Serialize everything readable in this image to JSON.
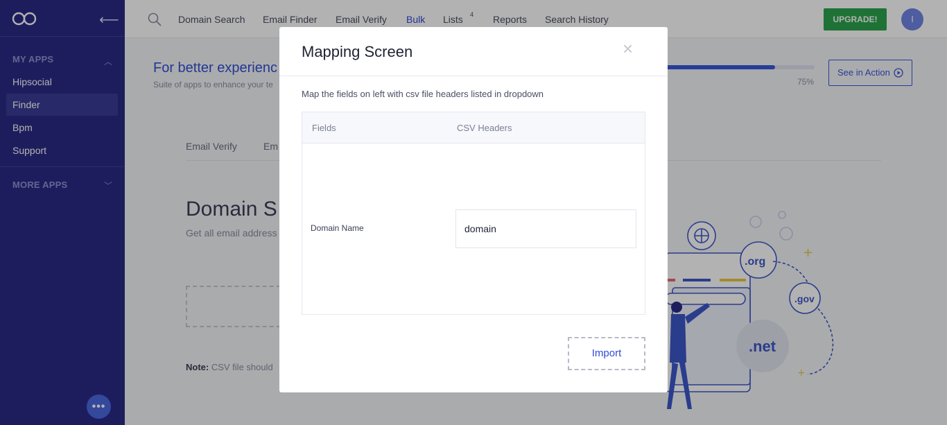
{
  "sidebar": {
    "logo_icon": "infinity-logo-icon",
    "collapse_icon": "arrow-left-icon",
    "my_apps_label": "MY APPS",
    "more_apps_label": "MORE APPS",
    "items": [
      {
        "label": "Hipsocial"
      },
      {
        "label": "Finder"
      },
      {
        "label": "Bpm"
      },
      {
        "label": "Support"
      }
    ],
    "chat_label": "•••"
  },
  "topnav": {
    "items": [
      "Domain Search",
      "Email Finder",
      "Email Verify",
      "Bulk",
      "Lists",
      "Reports",
      "Search History"
    ],
    "active": "Bulk",
    "lists_badge": "4",
    "upgrade_label": "UPGRADE!",
    "avatar_initial": "I"
  },
  "promo": {
    "title": "For better experienc",
    "subtitle": "Suite of apps to enhance your te",
    "progress": 0.75,
    "progress_label": "75%",
    "see_action_label": "See in Action"
  },
  "main": {
    "tabs": [
      "Email Verify",
      "Em"
    ],
    "title": "Domain S",
    "subtitle": "Get all email address",
    "note_bold": "Note:",
    "note_text": "CSV file should"
  },
  "illustration": {
    "labels": [
      ".org",
      ".gov",
      ".net"
    ]
  },
  "modal": {
    "title": "Mapping Screen",
    "close_label": "×",
    "description": "Map the fields on left with csv file headers listed in dropdown",
    "columns": [
      "Fields",
      "CSV Headers"
    ],
    "rows": [
      {
        "field": "Domain Name",
        "value": "domain"
      }
    ],
    "import_label": "Import"
  },
  "colors": {
    "sidebar": "#2a2a87",
    "accent": "#2f4bd6",
    "upgrade": "#2da44e"
  }
}
